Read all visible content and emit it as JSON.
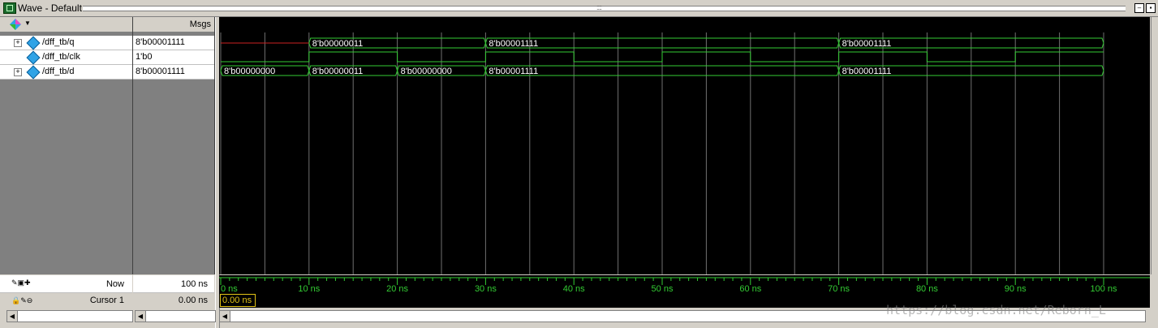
{
  "window": {
    "title": "Wave - Default"
  },
  "columns": {
    "msgs": "Msgs"
  },
  "signals": [
    {
      "name": "/dff_tb/q",
      "value": "8'b00001111",
      "expandable": true
    },
    {
      "name": "/dff_tb/clk",
      "value": "1'b0",
      "expandable": false
    },
    {
      "name": "/dff_tb/d",
      "value": "8'b00001111",
      "expandable": true
    }
  ],
  "waveform": {
    "time_unit": "ns",
    "range": [
      0,
      100
    ],
    "q_segments": [
      {
        "start": 0,
        "end": 10,
        "label": ""
      },
      {
        "start": 10,
        "end": 30,
        "label": "8'b00000011"
      },
      {
        "start": 30,
        "end": 70,
        "label": "8'b00001111"
      },
      {
        "start": 70,
        "end": 100,
        "label": "8'b00001111"
      }
    ],
    "clk_edges": [
      {
        "t": 0,
        "v": 0
      },
      {
        "t": 10,
        "v": 1
      },
      {
        "t": 20,
        "v": 0
      },
      {
        "t": 30,
        "v": 1
      },
      {
        "t": 40,
        "v": 0
      },
      {
        "t": 50,
        "v": 1
      },
      {
        "t": 60,
        "v": 0
      },
      {
        "t": 70,
        "v": 1
      },
      {
        "t": 80,
        "v": 0
      },
      {
        "t": 90,
        "v": 1
      },
      {
        "t": 100,
        "v": 1
      }
    ],
    "d_segments": [
      {
        "start": 0,
        "end": 10,
        "label": "8'b00000000"
      },
      {
        "start": 10,
        "end": 20,
        "label": "8'b00000011"
      },
      {
        "start": 20,
        "end": 30,
        "label": "8'b00000000"
      },
      {
        "start": 30,
        "end": 70,
        "label": "8'b00001111"
      },
      {
        "start": 70,
        "end": 100,
        "label": "8'b00001111"
      }
    ],
    "tick_labels": [
      "0 ns",
      "10 ns",
      "20 ns",
      "30 ns",
      "40 ns",
      "50 ns",
      "60 ns",
      "70 ns",
      "80 ns",
      "90 ns",
      "100 ns"
    ],
    "colors": {
      "wave": "#33cc33",
      "grid": "#707070",
      "undefined": "#cc2222",
      "cursor": "#e3c317"
    }
  },
  "status": {
    "now_label": "Now",
    "now_value": "100 ns",
    "cursor_label": "Cursor 1",
    "cursor_value": "0.00 ns",
    "cursor_box": "0.00 ns"
  },
  "watermark": "https://blog.csdn.net/Reborn_L"
}
